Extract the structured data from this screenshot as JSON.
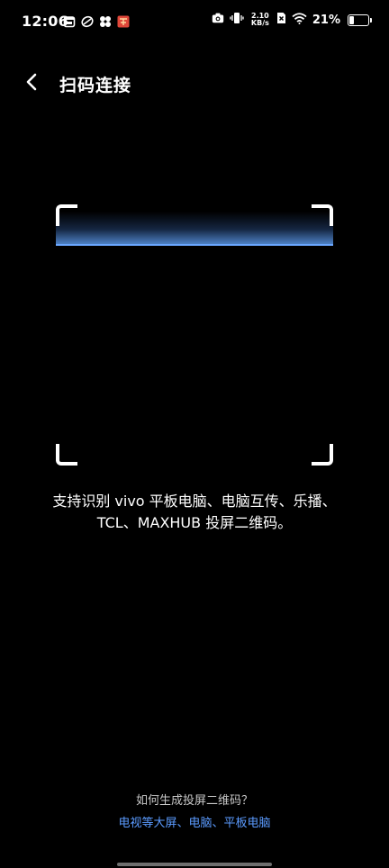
{
  "status_bar": {
    "time": "12:06",
    "net_speed_value": "2.10",
    "net_speed_unit": "KB/s",
    "battery_text": "21%",
    "battery_level": 0.21,
    "left_icons": [
      "calendar-icon",
      "wallet-icon",
      "pinwheel-icon",
      "app-badge-icon"
    ],
    "right_icons": [
      "camera-icon",
      "vibrate-icon",
      "sim-off-icon",
      "wifi-icon",
      "battery-icon"
    ]
  },
  "header": {
    "title": "扫码连接",
    "back_icon": "chevron-left-icon"
  },
  "scan": {
    "support_line1": "支持识别 vivo 平板电脑、电脑互传、乐播、",
    "support_line2": "TCL、MAXHUB 投屏二维码。"
  },
  "help": {
    "question": "如何生成投屏二维码？",
    "link": "电视等大屏、电脑、平板电脑"
  },
  "colors": {
    "background": "#000000",
    "link": "#5b9bff",
    "scan_line": "#6aa6ff"
  }
}
